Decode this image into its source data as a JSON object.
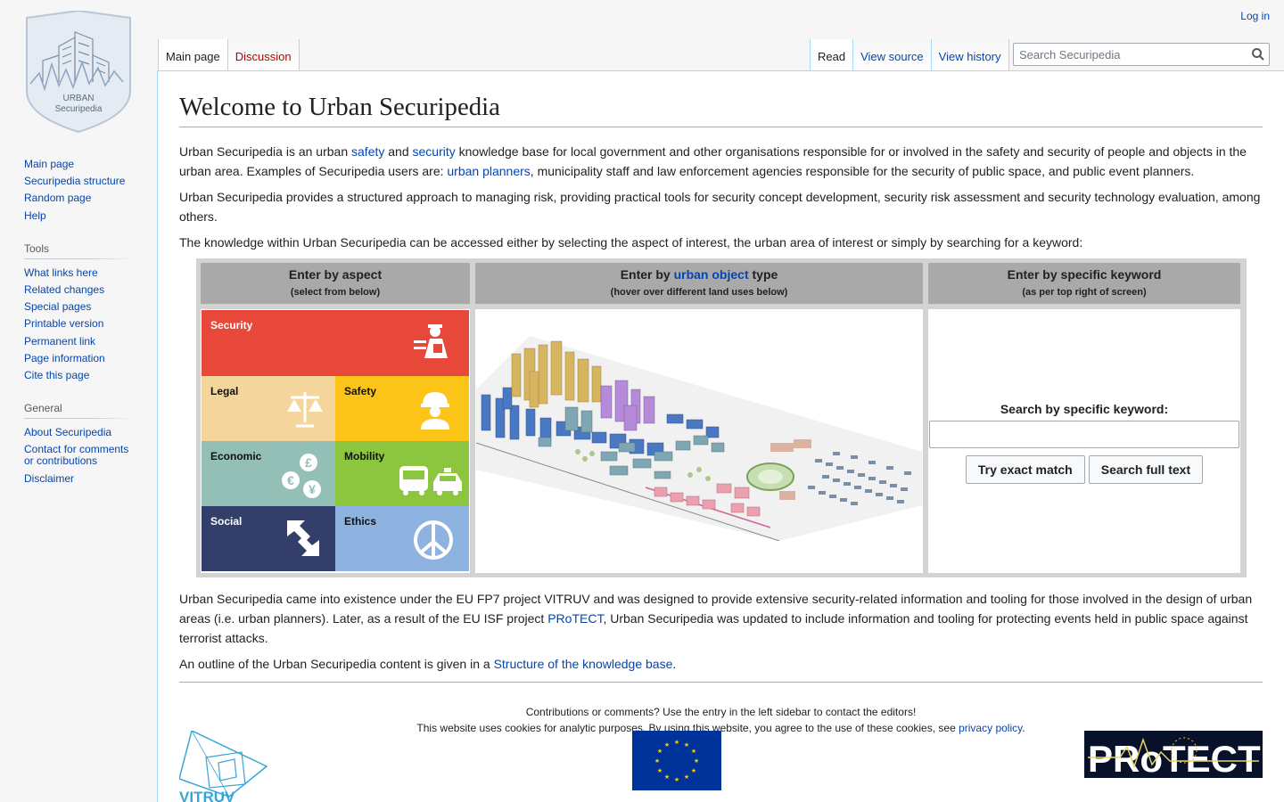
{
  "logo": {
    "line1": "URBAN",
    "line2": "Securipedia"
  },
  "personal": {
    "login": "Log in"
  },
  "tabs": {
    "main_page": "Main page",
    "discussion": "Discussion"
  },
  "views": {
    "read": "Read",
    "view_source": "View source",
    "view_history": "View history"
  },
  "search": {
    "placeholder": "Search Securipedia"
  },
  "sidebar": {
    "navigation": [
      "Main page",
      "Securipedia structure",
      "Random page",
      "Help"
    ],
    "tools_heading": "Tools",
    "tools": [
      "What links here",
      "Related changes",
      "Special pages",
      "Printable version",
      "Permanent link",
      "Page information",
      "Cite this page"
    ],
    "general_heading": "General",
    "general": [
      "About Securipedia",
      "Contact for comments or contributions",
      "Disclaimer"
    ]
  },
  "page": {
    "title": "Welcome to Urban Securipedia",
    "p1": {
      "a": "Urban Securipedia is an urban ",
      "link_safety": "safety",
      "b": " and ",
      "link_security": "security",
      "c": " knowledge base for local government and other organisations responsible for or involved in the safety and security of people and objects in the urban area. Examples of Securipedia users are: ",
      "link_planners": "urban planners",
      "d": ", municipality staff and law enforcement agencies responsible for the security of public space, and public event planners."
    },
    "p2": "Urban Securipedia provides a structured approach to managing risk, providing practical tools for security concept development, security risk assessment and security technology evaluation, among others.",
    "p3": "The knowledge within Urban Securipedia can be accessed either by selecting the aspect of interest, the urban area of interest or simply by searching for a keyword:",
    "table": {
      "col1_title": "Enter by aspect",
      "col1_sub": "(select from below)",
      "col2_pre": "Enter by ",
      "col2_link": "urban object",
      "col2_post": " type",
      "col2_sub": "(hover over different land uses below)",
      "col3_title": "Enter by specific keyword",
      "col3_sub": "(as per top right of screen)",
      "aspects": [
        "Security",
        "Legal",
        "Safety",
        "Economic",
        "Mobility",
        "Social",
        "Ethics"
      ],
      "search_label": "Search by specific keyword:",
      "btn_exact": "Try exact match",
      "btn_full": "Search full text"
    },
    "p4": {
      "a": "Urban Securipedia came into existence under the EU FP7 project VITRUV and was designed to provide extensive security-related information and tooling for those involved in the design of urban areas (i.e. urban planners). Later, as a result of the EU ISF project ",
      "link": "PRoTECT",
      "b": ", Urban Securipedia was updated to include information and tooling for protecting events held in public space against terrorist attacks."
    },
    "p5": {
      "a": "An outline of the Urban Securipedia content is given in a ",
      "link": "Structure of the knowledge base",
      "b": "."
    },
    "footer_line1": "Contributions or comments? Use the entry in the left sidebar to contact the editors!",
    "footer_line2_a": "This website uses cookies for analytic purposes. By using this website, you agree to the use of these cookies, see ",
    "footer_line2_link": "privacy policy",
    "footer_line2_b": ".",
    "logo_vitruv": "VITRUV",
    "logo_protect": "PRoTECT"
  },
  "colors": {
    "security": "#e8483a",
    "legal": "#f4d59b",
    "safety": "#fcc419",
    "economic": "#93bfb7",
    "mobility": "#8cc63f",
    "social": "#333f6a",
    "ethics": "#8fb3e0"
  }
}
